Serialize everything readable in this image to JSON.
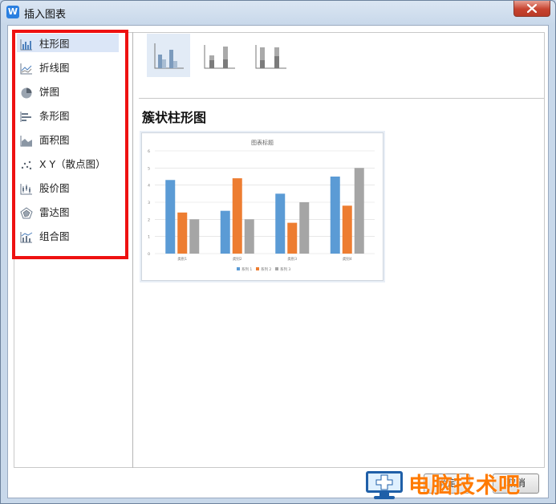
{
  "dialog": {
    "title": "插入图表"
  },
  "sidebar": {
    "items": [
      {
        "label": "柱形图",
        "icon": "column-chart-icon",
        "selected": true
      },
      {
        "label": "折线图",
        "icon": "line-chart-icon",
        "selected": false
      },
      {
        "label": "饼图",
        "icon": "pie-chart-icon",
        "selected": false
      },
      {
        "label": "条形图",
        "icon": "bar-chart-icon",
        "selected": false
      },
      {
        "label": "面积图",
        "icon": "area-chart-icon",
        "selected": false
      },
      {
        "label": "X Y（散点图）",
        "icon": "scatter-chart-icon",
        "selected": false
      },
      {
        "label": "股价图",
        "icon": "stock-chart-icon",
        "selected": false
      },
      {
        "label": "雷达图",
        "icon": "radar-chart-icon",
        "selected": false
      },
      {
        "label": "组合图",
        "icon": "combo-chart-icon",
        "selected": false
      }
    ]
  },
  "subtypes": [
    "clustered-column-icon",
    "stacked-column-icon",
    "percent-stacked-column-icon"
  ],
  "main": {
    "heading": "簇状柱形图"
  },
  "buttons": {
    "ok_label": "确定",
    "cancel_label": "取消"
  },
  "watermark": {
    "text": "电脑技术吧"
  },
  "colors": {
    "accent": "#5b9bd5",
    "series2": "#ed7d31",
    "series3": "#a5a5a5",
    "highlight_box": "#ee1111"
  },
  "chart_data": {
    "type": "bar",
    "title": "图表标题",
    "categories": [
      "类别1",
      "类别2",
      "类别3",
      "类别4"
    ],
    "series": [
      {
        "name": "系列 1",
        "values": [
          4.3,
          2.5,
          3.5,
          4.5
        ]
      },
      {
        "name": "系列 2",
        "values": [
          2.4,
          4.4,
          1.8,
          2.8
        ]
      },
      {
        "name": "系列 3",
        "values": [
          2.0,
          2.0,
          3.0,
          5.0
        ]
      }
    ],
    "ylim": [
      0,
      6
    ],
    "yticks": [
      "0",
      "1",
      "2",
      "3",
      "4",
      "5",
      "6"
    ],
    "grid": true,
    "legend": "bottom"
  }
}
